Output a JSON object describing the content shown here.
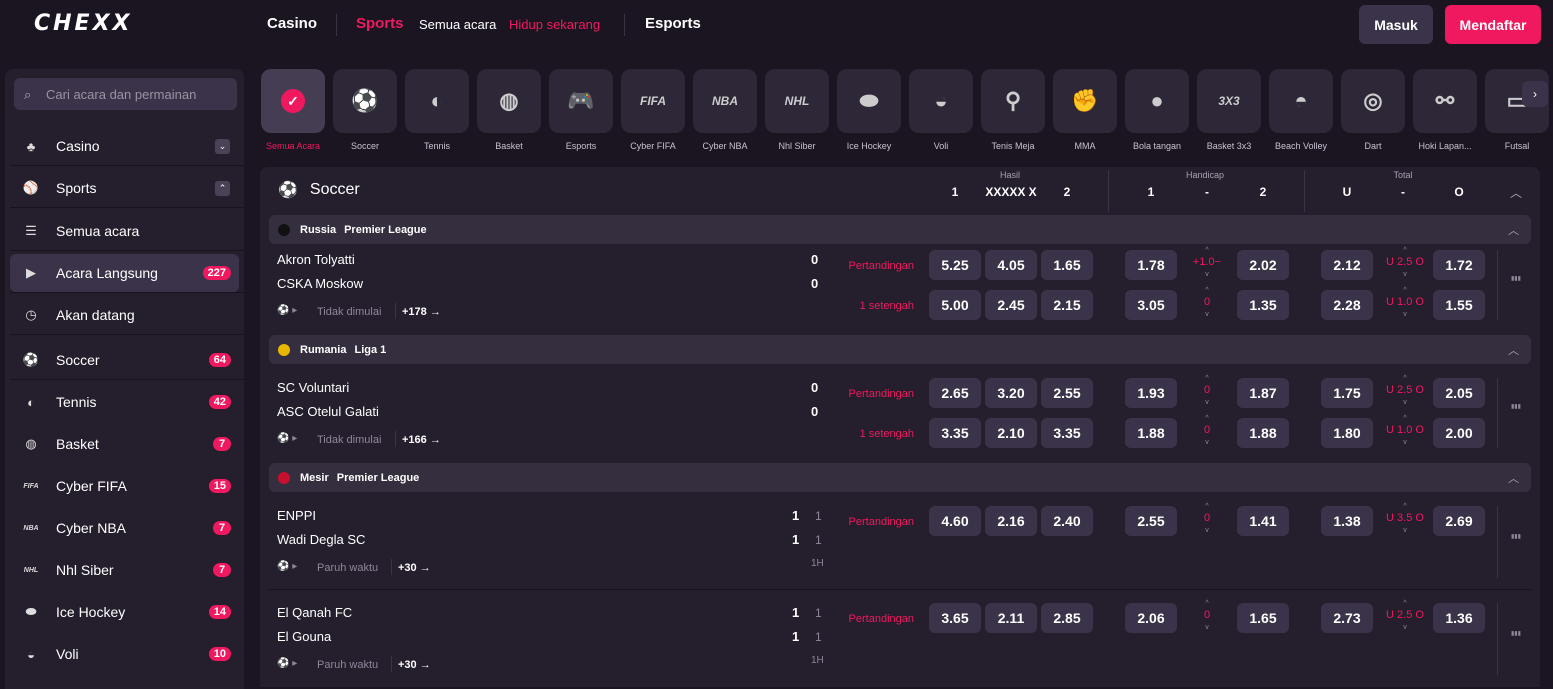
{
  "header": {
    "logo": "CHEXX",
    "nav": [
      "Casino",
      "Sports",
      "Semua acara",
      "Hidup sekarang",
      "Esports"
    ],
    "login": "Masuk",
    "register": "Mendaftar"
  },
  "sidebar": {
    "search_placeholder": "Cari acara dan permainan",
    "items": [
      {
        "label": "Casino",
        "icon": "casino-icon"
      },
      {
        "label": "Sports",
        "icon": "sports-icon"
      },
      {
        "label": "Semua acara",
        "icon": "list-icon"
      },
      {
        "label": "Acara Langsung",
        "icon": "play-icon",
        "badge": "227"
      },
      {
        "label": "Akan datang",
        "icon": "clock-icon"
      },
      {
        "label": "Soccer",
        "icon": "soccer-icon",
        "badge": "64"
      },
      {
        "label": "Tennis",
        "icon": "tennis-icon",
        "badge": "42"
      },
      {
        "label": "Basket",
        "icon": "basketball-icon",
        "badge": "7"
      },
      {
        "label": "Cyber FIFA",
        "icon": "fifa-icon",
        "badge": "15"
      },
      {
        "label": "Cyber NBA",
        "icon": "nba-icon",
        "badge": "7"
      },
      {
        "label": "Nhl Siber",
        "icon": "nhl-icon",
        "badge": "7"
      },
      {
        "label": "Ice Hockey",
        "icon": "ice-hockey-icon",
        "badge": "14"
      },
      {
        "label": "Voli",
        "icon": "volleyball-icon",
        "badge": "10"
      }
    ]
  },
  "categories": [
    {
      "label": "Semua Acara",
      "glyph": "✓"
    },
    {
      "label": "Soccer",
      "glyph": "⚽"
    },
    {
      "label": "Tennis",
      "glyph": "◐"
    },
    {
      "label": "Basket",
      "glyph": "◍"
    },
    {
      "label": "Esports",
      "glyph": "🎮"
    },
    {
      "label": "Cyber FIFA",
      "glyph": "FIFA"
    },
    {
      "label": "Cyber NBA",
      "glyph": "NBA"
    },
    {
      "label": "Nhl Siber",
      "glyph": "NHL"
    },
    {
      "label": "Ice Hockey",
      "glyph": "⬬"
    },
    {
      "label": "Voli",
      "glyph": "◒"
    },
    {
      "label": "Tenis Meja",
      "glyph": "⚲"
    },
    {
      "label": "MMA",
      "glyph": "✊"
    },
    {
      "label": "Bola tangan",
      "glyph": "●"
    },
    {
      "label": "Basket 3x3",
      "glyph": "3X3"
    },
    {
      "label": "Beach Volley",
      "glyph": "◓"
    },
    {
      "label": "Dart",
      "glyph": "◎"
    },
    {
      "label": "Hoki Lapan...",
      "glyph": "⚯"
    },
    {
      "label": "Futsal",
      "glyph": "▭"
    }
  ],
  "main": {
    "sport": "Soccer",
    "groups": {
      "hasil": "Hasil",
      "handicap": "Handicap",
      "total": "Total"
    },
    "cols": {
      "h1": "1",
      "hx": "XXXXX X",
      "h2": "2",
      "hc1": "1",
      "hcmid": "-",
      "hc2": "2",
      "tu": "U",
      "tmid": "-",
      "to": "O"
    }
  },
  "leagues": [
    {
      "country": "Russia",
      "name": "Premier League",
      "flag": "#111111"
    },
    {
      "country": "Rumania",
      "name": "Liga 1",
      "flag": "#e8b800"
    },
    {
      "country": "Mesir",
      "name": "Premier League",
      "flag": "#c8102e"
    }
  ],
  "matches": [
    {
      "home": "Akron Tolyatti",
      "away": "CSKA Moskow",
      "sh": "0",
      "sa": "0",
      "status": "Tidak dimulai",
      "more": "+178 →",
      "rows": [
        {
          "label": "Pertandingan",
          "o1": "5.25",
          "ox": "4.05",
          "o2": "1.65",
          "h1": "1.78",
          "hm": "+1.0−",
          "h2": "2.02",
          "t1": "2.12",
          "tm": "U 2.5 O",
          "t2": "1.72"
        },
        {
          "label": "1 setengah",
          "o1": "5.00",
          "ox": "2.45",
          "o2": "2.15",
          "h1": "3.05",
          "hm": "0",
          "h2": "1.35",
          "t1": "2.28",
          "tm": "U 1.0 O",
          "t2": "1.55"
        }
      ]
    },
    {
      "home": "SC Voluntari",
      "away": "ASC Otelul Galati",
      "sh": "0",
      "sa": "0",
      "status": "Tidak dimulai",
      "more": "+166 →",
      "rows": [
        {
          "label": "Pertandingan",
          "o1": "2.65",
          "ox": "3.20",
          "o2": "2.55",
          "h1": "1.93",
          "hm": "0",
          "h2": "1.87",
          "t1": "1.75",
          "tm": "U 2.5 O",
          "t2": "2.05"
        },
        {
          "label": "1 setengah",
          "o1": "3.35",
          "ox": "2.10",
          "o2": "3.35",
          "h1": "1.88",
          "hm": "0",
          "h2": "1.88",
          "t1": "1.80",
          "tm": "U 1.0 O",
          "t2": "2.00"
        }
      ]
    },
    {
      "home": "ENPPI",
      "away": "Wadi Degla SC",
      "sh": "1",
      "sa": "1",
      "sh2": "1",
      "sa2": "1",
      "half": "1H",
      "status": "Paruh waktu",
      "more": "+30 →",
      "rows": [
        {
          "label": "Pertandingan",
          "o1": "4.60",
          "ox": "2.16",
          "o2": "2.40",
          "h1": "2.55",
          "hm": "0",
          "h2": "1.41",
          "t1": "1.38",
          "tm": "U 3.5 O",
          "t2": "2.69"
        }
      ]
    },
    {
      "home": "El Qanah FC",
      "away": "El Gouna",
      "sh": "1",
      "sa": "1",
      "sh2": "1",
      "sa2": "1",
      "half": "1H",
      "status": "Paruh waktu",
      "more": "+30 →",
      "rows": [
        {
          "label": "Pertandingan",
          "o1": "3.65",
          "ox": "2.11",
          "o2": "2.85",
          "h1": "2.06",
          "hm": "0",
          "h2": "1.65",
          "t1": "2.73",
          "tm": "U 2.5 O",
          "t2": "1.36"
        }
      ]
    }
  ]
}
